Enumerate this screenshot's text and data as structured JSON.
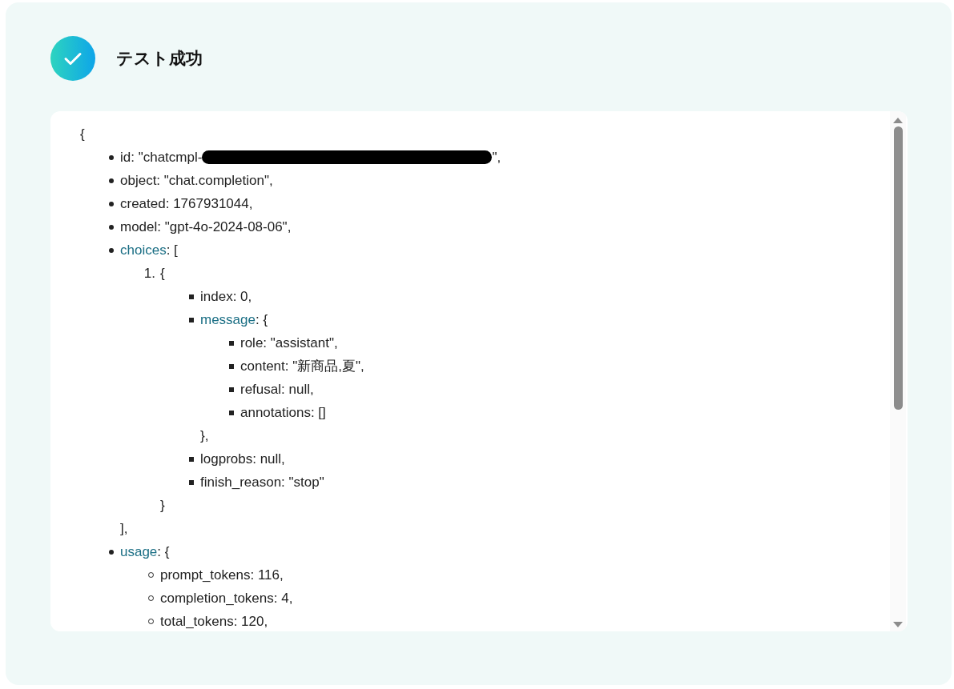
{
  "header": {
    "title": "テスト成功"
  },
  "output": {
    "open": "{",
    "items": [
      {
        "kind": "disc",
        "text": "id: \"chatcmpl-",
        "redacted": true,
        "after": "\","
      },
      {
        "kind": "disc",
        "text": "object: \"chat.completion\","
      },
      {
        "kind": "disc",
        "text": "created: 1767931044,"
      },
      {
        "kind": "disc",
        "text": "model: \"gpt-4o-2024-08-06\","
      },
      {
        "kind": "disc",
        "key": "choices",
        "text": ": [",
        "close": "],",
        "children": [
          {
            "kind": "number",
            "marker": "1.",
            "text": "{",
            "close": "}",
            "children": [
              {
                "kind": "square",
                "text": "index: 0,"
              },
              {
                "kind": "square",
                "key": "message",
                "text": ": {",
                "close": "},",
                "children": [
                  {
                    "kind": "square",
                    "text": "role: \"assistant\","
                  },
                  {
                    "kind": "square",
                    "text": "content: \"新商品,夏\","
                  },
                  {
                    "kind": "square",
                    "text": "refusal: null,"
                  },
                  {
                    "kind": "square",
                    "text": "annotations: []"
                  }
                ]
              },
              {
                "kind": "square",
                "text": "logprobs: null,"
              },
              {
                "kind": "square",
                "text": "finish_reason: \"stop\""
              }
            ]
          }
        ]
      },
      {
        "kind": "disc",
        "key": "usage",
        "text": ": {",
        "children": [
          {
            "kind": "circle",
            "text": "prompt_tokens: 116,"
          },
          {
            "kind": "circle",
            "text": "completion_tokens: 4,"
          },
          {
            "kind": "circle",
            "text": "total_tokens: 120,"
          }
        ]
      }
    ]
  }
}
